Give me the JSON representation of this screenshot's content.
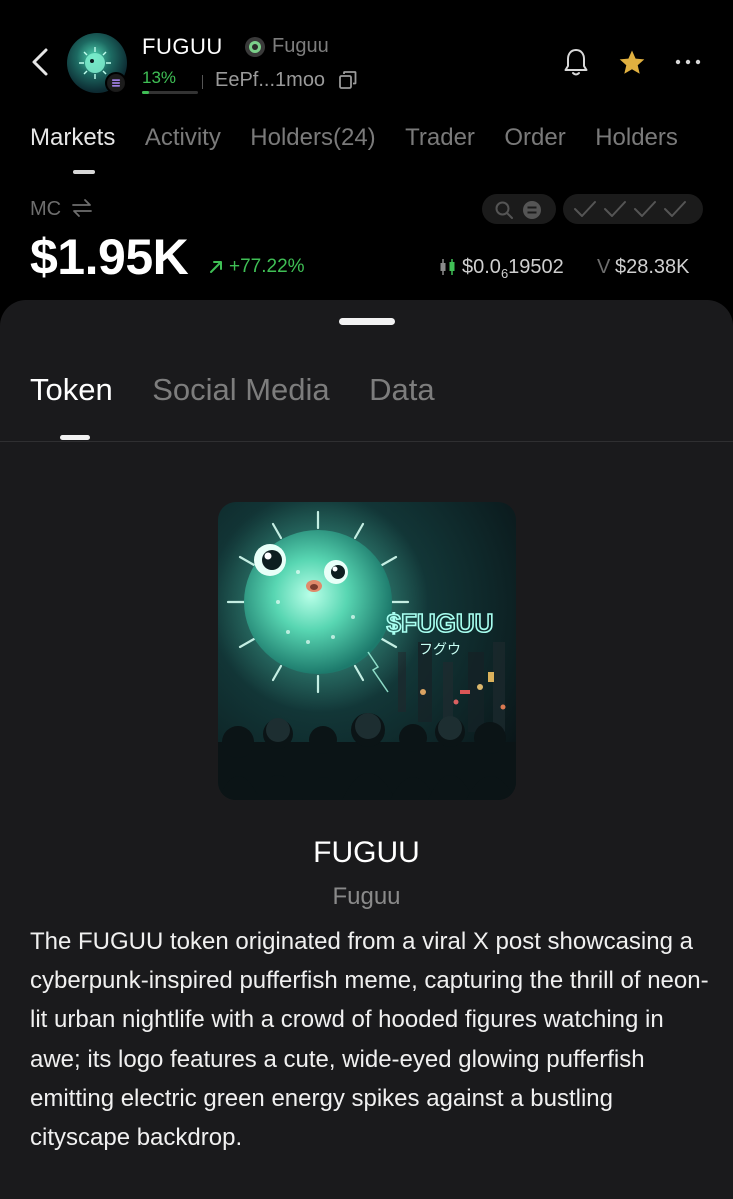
{
  "header": {
    "token_name": "FUGUU",
    "token_subname": "Fuguu",
    "progress_label": "13%",
    "progress_value": 0.13,
    "address": "EePf...1moo"
  },
  "tabs": [
    {
      "label": "Markets",
      "active": true
    },
    {
      "label": "Activity",
      "active": false
    },
    {
      "label": "Holders(24)",
      "active": false
    },
    {
      "label": "Trader",
      "active": false
    },
    {
      "label": "Order",
      "active": false
    },
    {
      "label": "Holders",
      "active": false
    }
  ],
  "market": {
    "mc_label": "MC",
    "mc_value": "$1.95K",
    "change": "+77.22%",
    "price": "$0.0619502",
    "price_subscript_digit": "6",
    "volume_label": "V",
    "volume": "$28.38K"
  },
  "sheet": {
    "tabs": [
      {
        "label": "Token",
        "active": true
      },
      {
        "label": "Social Media",
        "active": false
      },
      {
        "label": "Data",
        "active": false
      }
    ],
    "token_title": "FUGUU",
    "token_subtitle": "Fuguu",
    "image_text_main": "$FUGUU",
    "image_text_jp": "フグウ",
    "description": "The FUGUU token originated from a viral X post showcasing a cyberpunk-inspired pufferfish meme, capturing the thrill of neon-lit urban nightlife with a crowd of hooded figures watching in awe; its logo features a cute, wide-eyed glowing pufferfish emitting electric green energy spikes against a bustling cityscape backdrop."
  },
  "colors": {
    "background": "#000000",
    "sheet": "#1a1a1c",
    "positive": "#3fbf55",
    "star": "#e0b040",
    "muted": "#7a7a7a"
  },
  "icons": [
    "back-chevron-icon",
    "solana-icon",
    "pump-icon",
    "copy-icon",
    "bell-icon",
    "star-icon",
    "more-icon",
    "swap-icon",
    "search-icon",
    "filter-icon",
    "check-icon",
    "trend-up-icon",
    "candle-icon"
  ]
}
